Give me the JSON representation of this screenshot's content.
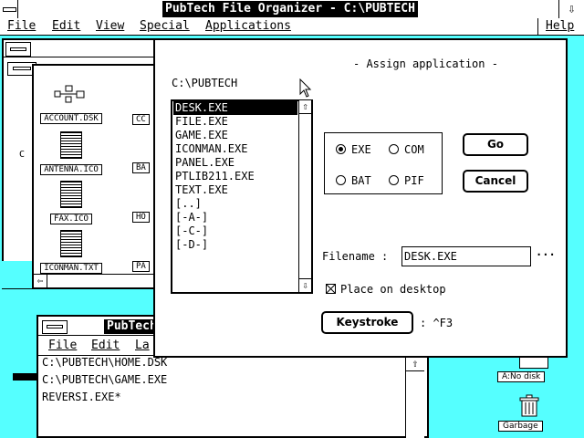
{
  "window": {
    "title": "PubTech File Organizer - C:\\PUBTECH",
    "scroll_glyph": "⇩"
  },
  "menu": {
    "file": "File",
    "edit": "Edit",
    "view": "View",
    "special": "Special",
    "applications": "Applications",
    "help": "Help"
  },
  "organizer": {
    "files": [
      {
        "label": "ACCOUNT.DSK"
      },
      {
        "label": "ANTENNA.ICO"
      },
      {
        "label": "FAX.ICO"
      },
      {
        "label": "ICONMAN.TXT"
      }
    ],
    "partial_labels": [
      "C",
      "BA",
      "HO",
      "PA"
    ]
  },
  "text_window": {
    "title": "PubTech",
    "menu": {
      "file": "File",
      "edit": "Edit",
      "layout": "La"
    },
    "lines": [
      "C:\\PUBTECH\\HOME.DSK",
      "C:\\PUBTECH\\GAME.EXE",
      "REVERSI.EXE*"
    ]
  },
  "desktop": {
    "drive_label": "A:No disk",
    "garbage_label": "Garbage"
  },
  "dialog": {
    "heading": "- Assign application -",
    "path": "C:\\PUBTECH",
    "list": [
      "DESK.EXE",
      "FILE.EXE",
      "GAME.EXE",
      "ICONMAN.EXE",
      "PANEL.EXE",
      "PTLIB211.EXE",
      "TEXT.EXE",
      "[..]",
      "[-A-]",
      "[-C-]",
      "[-D-]"
    ],
    "selected_index": 0,
    "types": {
      "exe": "EXE",
      "com": "COM",
      "bat": "BAT",
      "pif": "PIF"
    },
    "selected_type": "EXE",
    "go_label": "Go",
    "cancel_label": "Cancel",
    "filename_label": "Filename :",
    "filename_value": "DESK.EXE",
    "browse_label": "···",
    "place_on_desktop_label": "Place on desktop",
    "place_on_desktop_checked": true,
    "keystroke_label": "Keystroke",
    "keystroke_value": ": ^F3"
  }
}
